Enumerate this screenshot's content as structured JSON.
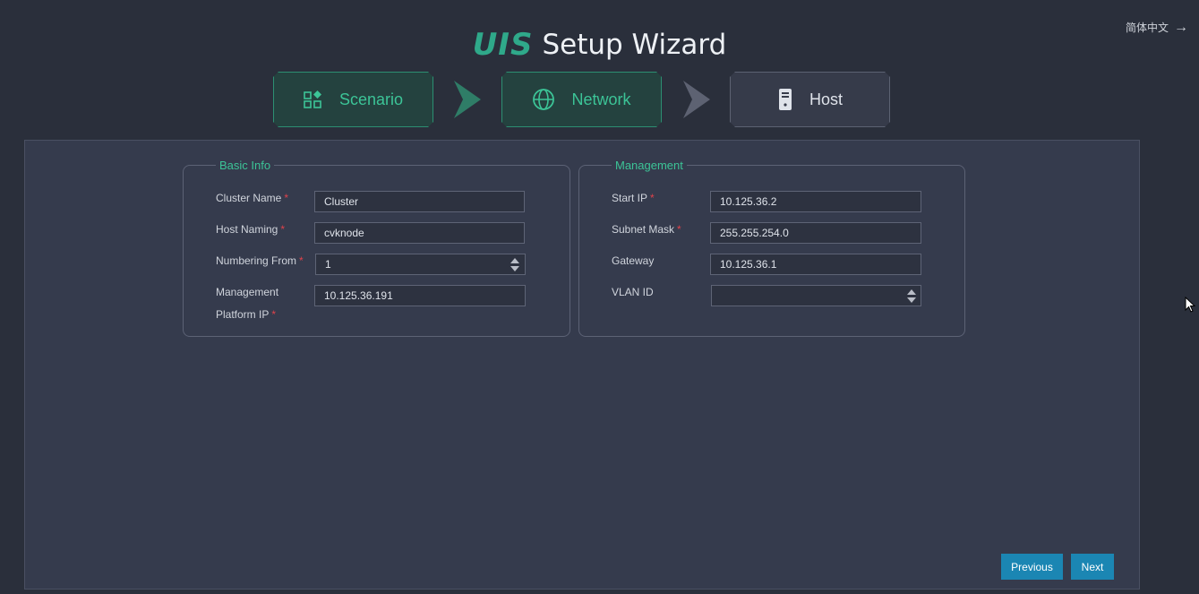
{
  "language_switch": {
    "label": "简体中文"
  },
  "header": {
    "logo": "UIS",
    "title": "Setup Wizard"
  },
  "steps": [
    {
      "label": "Scenario",
      "icon": "apps-icon",
      "state": "completed"
    },
    {
      "label": "Network",
      "icon": "globe-icon",
      "state": "current"
    },
    {
      "label": "Host",
      "icon": "server-icon",
      "state": "pending"
    }
  ],
  "basic_info": {
    "legend": "Basic Info",
    "cluster_name": {
      "label": "Cluster Name",
      "value": "Cluster"
    },
    "host_naming": {
      "label": "Host Naming",
      "value": "cvknode"
    },
    "numbering_from": {
      "label": "Numbering From",
      "value": "1"
    },
    "management_ip": {
      "label_line1": "Management",
      "label_line2": "Platform IP",
      "value": "10.125.36.191"
    }
  },
  "management": {
    "legend": "Management",
    "start_ip": {
      "label": "Start IP",
      "value": "10.125.36.2"
    },
    "subnet_mask": {
      "label": "Subnet Mask",
      "value": "255.255.254.0"
    },
    "gateway": {
      "label": "Gateway",
      "value": "10.125.36.1"
    },
    "vlan_id": {
      "label": "VLAN ID",
      "value": ""
    }
  },
  "required_marker": "*",
  "footer": {
    "previous_label": "Previous",
    "next_label": "Next"
  },
  "colors": {
    "accent_green": "#3cc497",
    "button_blue": "#1b86b3",
    "required_red": "#e0424b"
  }
}
